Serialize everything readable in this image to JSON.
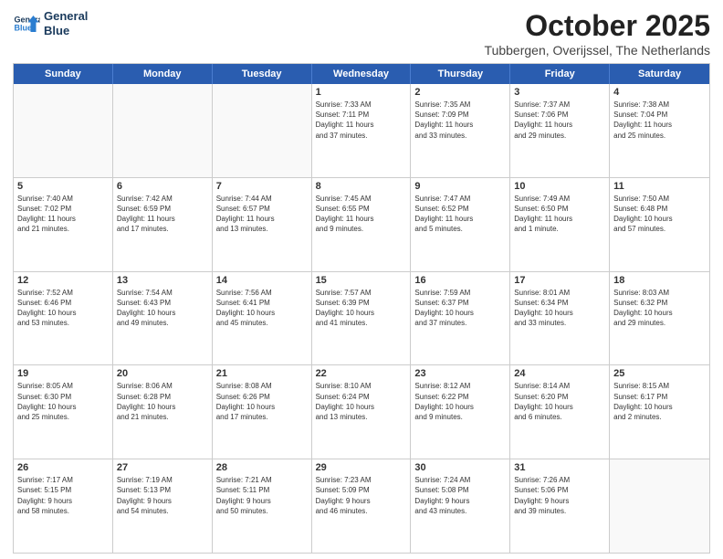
{
  "header": {
    "logo_line1": "General",
    "logo_line2": "Blue",
    "month": "October 2025",
    "location": "Tubbergen, Overijssel, The Netherlands"
  },
  "days_of_week": [
    "Sunday",
    "Monday",
    "Tuesday",
    "Wednesday",
    "Thursday",
    "Friday",
    "Saturday"
  ],
  "weeks": [
    [
      {
        "day": "",
        "info": ""
      },
      {
        "day": "",
        "info": ""
      },
      {
        "day": "",
        "info": ""
      },
      {
        "day": "1",
        "info": "Sunrise: 7:33 AM\nSunset: 7:11 PM\nDaylight: 11 hours\nand 37 minutes."
      },
      {
        "day": "2",
        "info": "Sunrise: 7:35 AM\nSunset: 7:09 PM\nDaylight: 11 hours\nand 33 minutes."
      },
      {
        "day": "3",
        "info": "Sunrise: 7:37 AM\nSunset: 7:06 PM\nDaylight: 11 hours\nand 29 minutes."
      },
      {
        "day": "4",
        "info": "Sunrise: 7:38 AM\nSunset: 7:04 PM\nDaylight: 11 hours\nand 25 minutes."
      }
    ],
    [
      {
        "day": "5",
        "info": "Sunrise: 7:40 AM\nSunset: 7:02 PM\nDaylight: 11 hours\nand 21 minutes."
      },
      {
        "day": "6",
        "info": "Sunrise: 7:42 AM\nSunset: 6:59 PM\nDaylight: 11 hours\nand 17 minutes."
      },
      {
        "day": "7",
        "info": "Sunrise: 7:44 AM\nSunset: 6:57 PM\nDaylight: 11 hours\nand 13 minutes."
      },
      {
        "day": "8",
        "info": "Sunrise: 7:45 AM\nSunset: 6:55 PM\nDaylight: 11 hours\nand 9 minutes."
      },
      {
        "day": "9",
        "info": "Sunrise: 7:47 AM\nSunset: 6:52 PM\nDaylight: 11 hours\nand 5 minutes."
      },
      {
        "day": "10",
        "info": "Sunrise: 7:49 AM\nSunset: 6:50 PM\nDaylight: 11 hours\nand 1 minute."
      },
      {
        "day": "11",
        "info": "Sunrise: 7:50 AM\nSunset: 6:48 PM\nDaylight: 10 hours\nand 57 minutes."
      }
    ],
    [
      {
        "day": "12",
        "info": "Sunrise: 7:52 AM\nSunset: 6:46 PM\nDaylight: 10 hours\nand 53 minutes."
      },
      {
        "day": "13",
        "info": "Sunrise: 7:54 AM\nSunset: 6:43 PM\nDaylight: 10 hours\nand 49 minutes."
      },
      {
        "day": "14",
        "info": "Sunrise: 7:56 AM\nSunset: 6:41 PM\nDaylight: 10 hours\nand 45 minutes."
      },
      {
        "day": "15",
        "info": "Sunrise: 7:57 AM\nSunset: 6:39 PM\nDaylight: 10 hours\nand 41 minutes."
      },
      {
        "day": "16",
        "info": "Sunrise: 7:59 AM\nSunset: 6:37 PM\nDaylight: 10 hours\nand 37 minutes."
      },
      {
        "day": "17",
        "info": "Sunrise: 8:01 AM\nSunset: 6:34 PM\nDaylight: 10 hours\nand 33 minutes."
      },
      {
        "day": "18",
        "info": "Sunrise: 8:03 AM\nSunset: 6:32 PM\nDaylight: 10 hours\nand 29 minutes."
      }
    ],
    [
      {
        "day": "19",
        "info": "Sunrise: 8:05 AM\nSunset: 6:30 PM\nDaylight: 10 hours\nand 25 minutes."
      },
      {
        "day": "20",
        "info": "Sunrise: 8:06 AM\nSunset: 6:28 PM\nDaylight: 10 hours\nand 21 minutes."
      },
      {
        "day": "21",
        "info": "Sunrise: 8:08 AM\nSunset: 6:26 PM\nDaylight: 10 hours\nand 17 minutes."
      },
      {
        "day": "22",
        "info": "Sunrise: 8:10 AM\nSunset: 6:24 PM\nDaylight: 10 hours\nand 13 minutes."
      },
      {
        "day": "23",
        "info": "Sunrise: 8:12 AM\nSunset: 6:22 PM\nDaylight: 10 hours\nand 9 minutes."
      },
      {
        "day": "24",
        "info": "Sunrise: 8:14 AM\nSunset: 6:20 PM\nDaylight: 10 hours\nand 6 minutes."
      },
      {
        "day": "25",
        "info": "Sunrise: 8:15 AM\nSunset: 6:17 PM\nDaylight: 10 hours\nand 2 minutes."
      }
    ],
    [
      {
        "day": "26",
        "info": "Sunrise: 7:17 AM\nSunset: 5:15 PM\nDaylight: 9 hours\nand 58 minutes."
      },
      {
        "day": "27",
        "info": "Sunrise: 7:19 AM\nSunset: 5:13 PM\nDaylight: 9 hours\nand 54 minutes."
      },
      {
        "day": "28",
        "info": "Sunrise: 7:21 AM\nSunset: 5:11 PM\nDaylight: 9 hours\nand 50 minutes."
      },
      {
        "day": "29",
        "info": "Sunrise: 7:23 AM\nSunset: 5:09 PM\nDaylight: 9 hours\nand 46 minutes."
      },
      {
        "day": "30",
        "info": "Sunrise: 7:24 AM\nSunset: 5:08 PM\nDaylight: 9 hours\nand 43 minutes."
      },
      {
        "day": "31",
        "info": "Sunrise: 7:26 AM\nSunset: 5:06 PM\nDaylight: 9 hours\nand 39 minutes."
      },
      {
        "day": "",
        "info": ""
      }
    ]
  ]
}
